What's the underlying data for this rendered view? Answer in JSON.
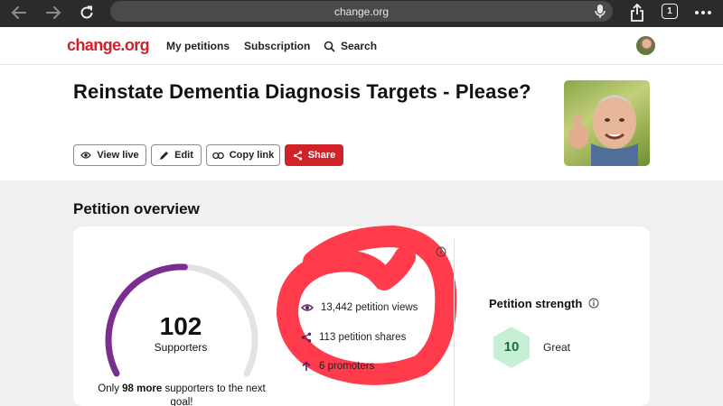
{
  "browser": {
    "url": "change.org",
    "tab_count": "1"
  },
  "header": {
    "logo": "change.org",
    "nav": {
      "my_petitions": "My petitions",
      "subscription": "Subscription",
      "search": "Search"
    }
  },
  "petition": {
    "title": "Reinstate Dementia Diagnosis Targets - Please?",
    "actions": {
      "view_live": "View live",
      "edit": "Edit",
      "copy_link": "Copy link",
      "share": "Share"
    }
  },
  "overview": {
    "title": "Petition overview",
    "supporters": {
      "count": "102",
      "label": "Supporters",
      "goal_progress": 0.51,
      "goal_prefix": "Only ",
      "goal_more": "98 more",
      "goal_suffix": " supporters to the next goal!"
    },
    "stats": {
      "views": "13,442 petition views",
      "shares": "113 petition shares",
      "promoters": "6 promoters"
    },
    "strength": {
      "title": "Petition strength",
      "score": "10",
      "rating": "Great"
    }
  },
  "colors": {
    "brand_red": "#cf2229",
    "gauge_purple": "#7a2f8f",
    "gauge_track": "#e3e3e3",
    "strength_hex": "#c6f0d6",
    "annotation_red": "#ff2a3d"
  },
  "icons": [
    "back-arrow-icon",
    "forward-arrow-icon",
    "reload-icon",
    "microphone-icon",
    "share-sheet-icon",
    "more-icon",
    "search-icon",
    "eye-icon",
    "pencil-icon",
    "link-icon",
    "share-icon",
    "info-icon",
    "up-arrow-icon"
  ]
}
